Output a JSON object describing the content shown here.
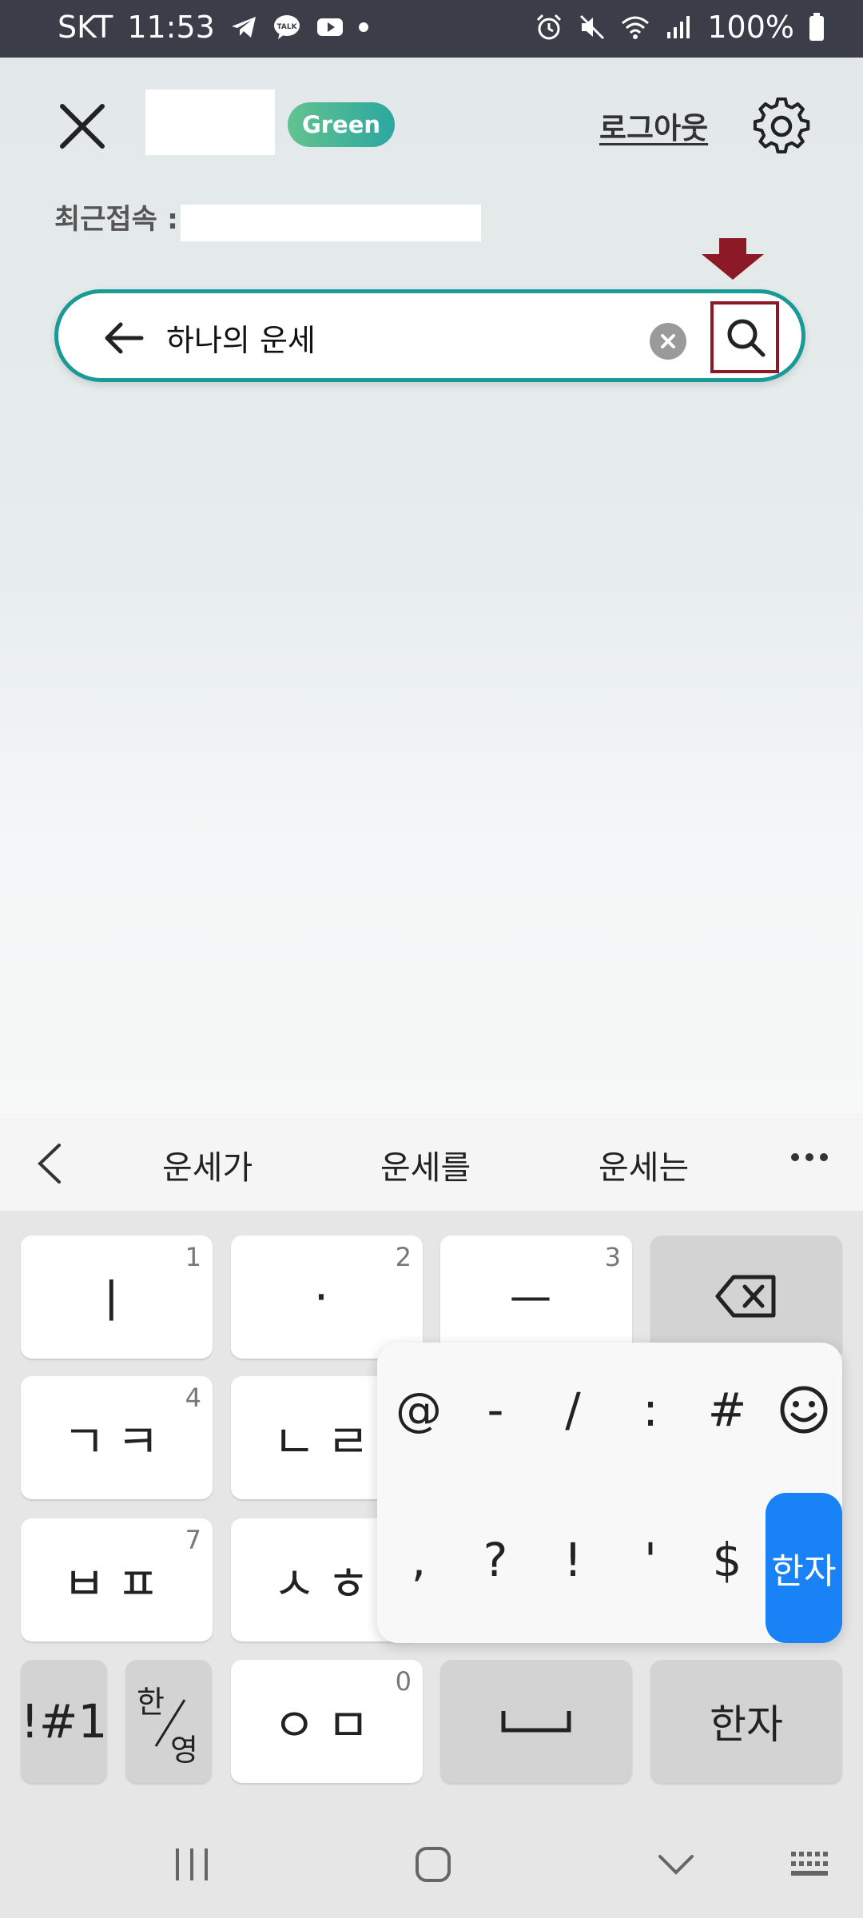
{
  "status_bar": {
    "carrier": "SKT",
    "time": "11:53",
    "battery": "100%"
  },
  "header": {
    "grade_badge": "Green",
    "logout_label": "로그아웃"
  },
  "last_login": {
    "label": "최근접속 :"
  },
  "search": {
    "query": "하나의 운세"
  },
  "keyboard": {
    "suggestions": [
      "운세가",
      "운세를",
      "운세는"
    ],
    "keys": {
      "k1": "ㅣ",
      "k1_num": "1",
      "k2": "·",
      "k2_num": "2",
      "k3": "ㅡ",
      "k3_num": "3",
      "k4": "ㄱㅋ",
      "k4_num": "4",
      "k5": "ㄴㄹ",
      "k7": "ㅂㅍ",
      "k7_num": "7",
      "k8": "ㅅㅎ",
      "k0": "ㅇㅁ",
      "k0_num": "0",
      "symbols": "!#1",
      "lang_top": "한",
      "lang_bottom": "영",
      "hanja": "한자"
    },
    "popup": {
      "row1": [
        "@",
        "-",
        "/",
        ":",
        "#"
      ],
      "row2": [
        ",",
        "?",
        "!",
        "'",
        "$"
      ],
      "active": "한자"
    }
  }
}
